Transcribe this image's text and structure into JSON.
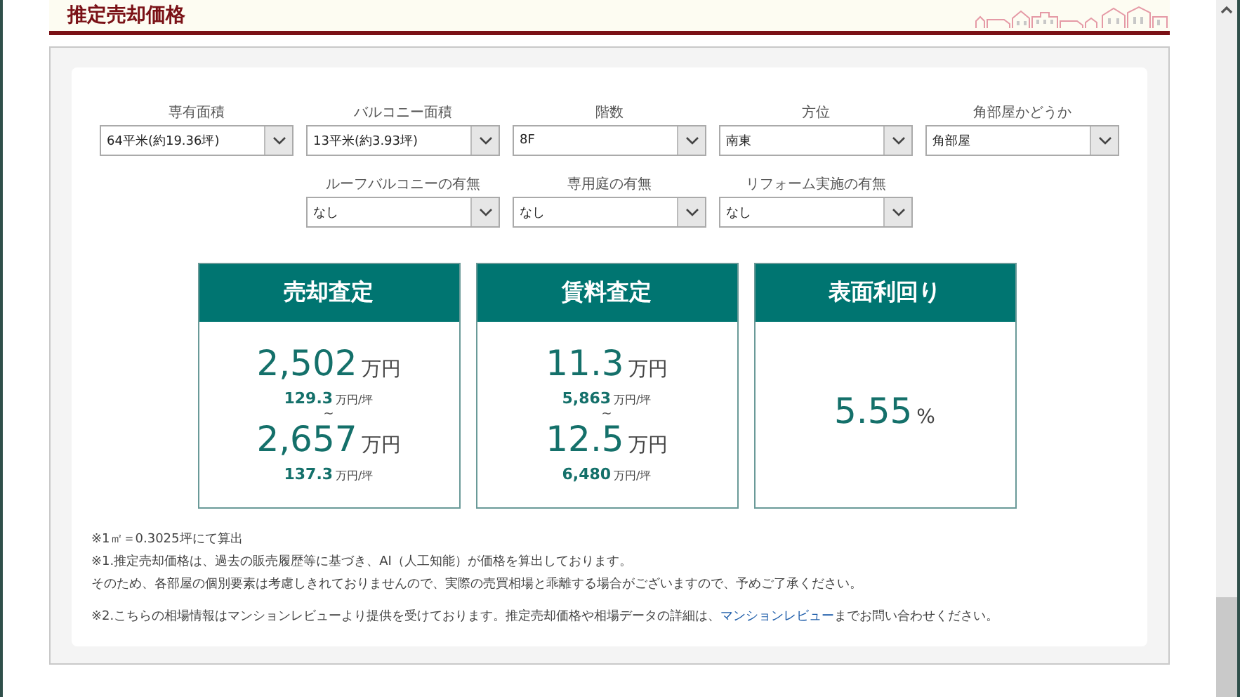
{
  "section_title": "推定売却価格",
  "fields": [
    {
      "label": "専有面積",
      "value": "64平米(約19.36坪)"
    },
    {
      "label": "バルコニー面積",
      "value": "13平米(約3.93坪)"
    },
    {
      "label": "階数",
      "value": "8F"
    },
    {
      "label": "方位",
      "value": "南東"
    },
    {
      "label": "角部屋かどうか",
      "value": "角部屋"
    },
    {
      "label": "ルーフバルコニーの有無",
      "value": "なし"
    },
    {
      "label": "専用庭の有無",
      "value": "なし"
    },
    {
      "label": "リフォーム実施の有無",
      "value": "なし"
    }
  ],
  "results": [
    {
      "title": "売却査定",
      "kind": "range",
      "low": {
        "value": "2,502",
        "unit": "万円",
        "sub_value": "129.3",
        "sub_unit": "万円/坪"
      },
      "separator": "~",
      "high": {
        "value": "2,657",
        "unit": "万円",
        "sub_value": "137.3",
        "sub_unit": "万円/坪"
      }
    },
    {
      "title": "賃料査定",
      "kind": "range",
      "low": {
        "value": "11.3",
        "unit": "万円",
        "sub_value": "5,863",
        "sub_unit": "万円/坪"
      },
      "separator": "~",
      "high": {
        "value": "12.5",
        "unit": "万円",
        "sub_value": "6,480",
        "sub_unit": "万円/坪"
      }
    },
    {
      "title": "表面利回り",
      "kind": "single",
      "value": "5.55",
      "unit": "%"
    }
  ],
  "notes": [
    {
      "kind": "text",
      "text": "※1㎡＝0.3025坪にて算出"
    },
    {
      "kind": "text",
      "text": "※1.推定売却価格は、過去の販売履歴等に基づき、AI（人工知能）が価格を算出しております。"
    },
    {
      "kind": "text",
      "text": "そのため、各部屋の個別要素は考慮しきれておりませんので、実際の売買相場と乖離する場合がございますので、予めご了承ください。"
    },
    {
      "kind": "link",
      "before": "※2.こちらの相場情報はマンションレビューより提供を受けております。推定売却価格や相場データの詳細は、",
      "link": "マンションレビュー",
      "after": "までお問い合わせください。"
    }
  ]
}
